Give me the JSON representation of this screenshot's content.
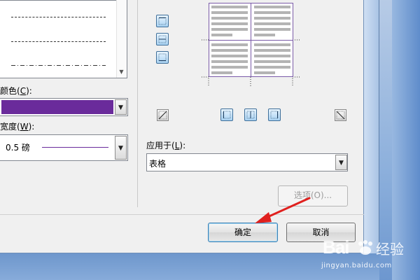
{
  "line_style": {
    "rows": [
      "dashed-short",
      "dashed-long",
      "dash-dot"
    ]
  },
  "color": {
    "label": "颜色",
    "accelerator": "C",
    "value": "#6a2b9b"
  },
  "width": {
    "label": "宽度",
    "accelerator": "W",
    "value": "0.5 磅"
  },
  "apply_to": {
    "label": "应用于",
    "accelerator": "L",
    "value": "表格"
  },
  "buttons": {
    "options": "选项(O)...",
    "ok": "确定",
    "cancel": "取消"
  },
  "watermark": {
    "brand": "Bai",
    "brand2": "经验",
    "url": "jingyan.baidu.com"
  },
  "colors": {
    "accent_purple": "#6a2b9b",
    "arrow_red": "#e0201e"
  }
}
